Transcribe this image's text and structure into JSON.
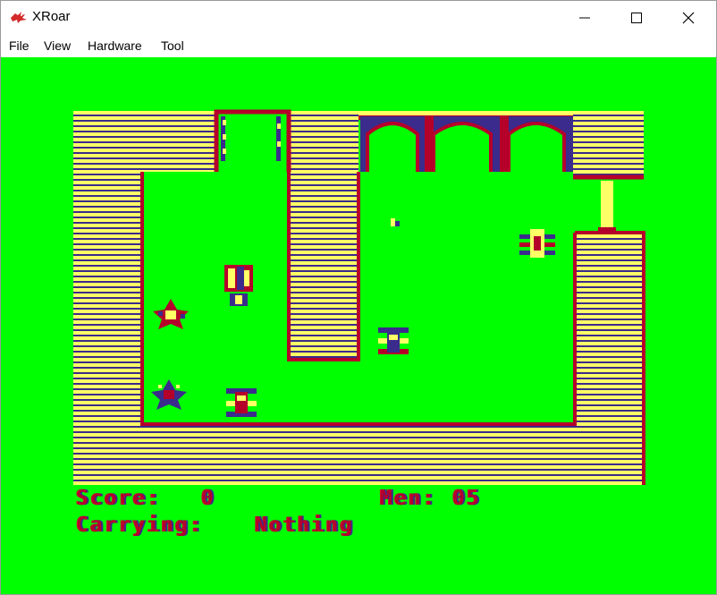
{
  "window": {
    "title": "XRoar",
    "app_icon": "dragon-icon",
    "controls": [
      "minimize-icon",
      "maximize-icon",
      "close-icon"
    ]
  },
  "menu": {
    "items": [
      {
        "label": "File"
      },
      {
        "label": "View"
      },
      {
        "label": "Hardware"
      },
      {
        "label": "Tool"
      }
    ]
  },
  "game": {
    "background_color": "#00ff00",
    "wall_colors": {
      "stripe_a": "#ffff66",
      "stripe_b": "#3a2b8c",
      "outline": "#b5002a"
    },
    "sprites": [
      "spider-enemy",
      "spider-enemy",
      "spider-enemy",
      "spider-enemy",
      "star-creature",
      "star-creature",
      "player-knight",
      "small-item"
    ]
  },
  "hud": {
    "score_label": "Score:",
    "score_value": "0",
    "men_label": "Men:",
    "men_value": "05",
    "carrying_label": "Carrying:",
    "carrying_value": "Nothing"
  }
}
